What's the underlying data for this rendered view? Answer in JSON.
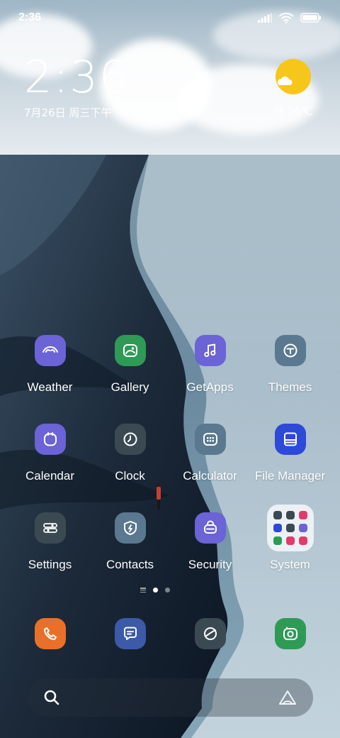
{
  "status_bar": {
    "time": "2:36",
    "icons": [
      "signal-icon",
      "wifi-icon",
      "battery-icon"
    ]
  },
  "clock_widget": {
    "time": "2:36",
    "date": "7月26日 周三下午"
  },
  "weather_widget": {
    "icon": "sun-cloud-icon",
    "condition_temp": "晴 26℃"
  },
  "apps": [
    {
      "label": "Weather",
      "icon": "weather-icon",
      "color": "#6b63d6"
    },
    {
      "label": "Gallery",
      "icon": "gallery-icon",
      "color": "#2f9a55"
    },
    {
      "label": "GetApps",
      "icon": "music-note-icon",
      "color": "#6b63d6"
    },
    {
      "label": "Themes",
      "icon": "themes-icon",
      "color": "#5a7890"
    },
    {
      "label": "Calendar",
      "icon": "calendar-icon",
      "color": "#6b63d6"
    },
    {
      "label": "Clock",
      "icon": "clock-icon",
      "color": "#3b4a52"
    },
    {
      "label": "Calculator",
      "icon": "calculator-icon",
      "color": "#5a7890"
    },
    {
      "label": "File Manager",
      "icon": "file-manager-icon",
      "color": "#2c49d8"
    },
    {
      "label": "Settings",
      "icon": "settings-icon",
      "color": "#3b4a52"
    },
    {
      "label": "Contacts",
      "icon": "shield-icon",
      "color": "#5a7890"
    },
    {
      "label": "Security",
      "icon": "security-icon",
      "color": "#6b63d6"
    },
    {
      "label": "System",
      "icon": "folder-icon",
      "color": "#f2f5f7"
    }
  ],
  "system_folder_mini_colors": [
    "#3b4a52",
    "#3b4a52",
    "#e23a6a",
    "#2c49d8",
    "#3b4a52",
    "#6b63d6",
    "#2f9a55",
    "#e23a6a",
    "#e23a6a"
  ],
  "page_indicator": {
    "total_pages": 2,
    "current_page": 1
  },
  "dock": [
    {
      "icon": "phone-icon",
      "color": "#e8702a"
    },
    {
      "icon": "messages-icon",
      "color": "#3c5aa8"
    },
    {
      "icon": "browser-icon",
      "color": "#3b4a52"
    },
    {
      "icon": "camera-icon",
      "color": "#2f9a55"
    }
  ],
  "search_bar": {
    "left_icon": "search-icon",
    "right_icon": "assistant-icon"
  }
}
